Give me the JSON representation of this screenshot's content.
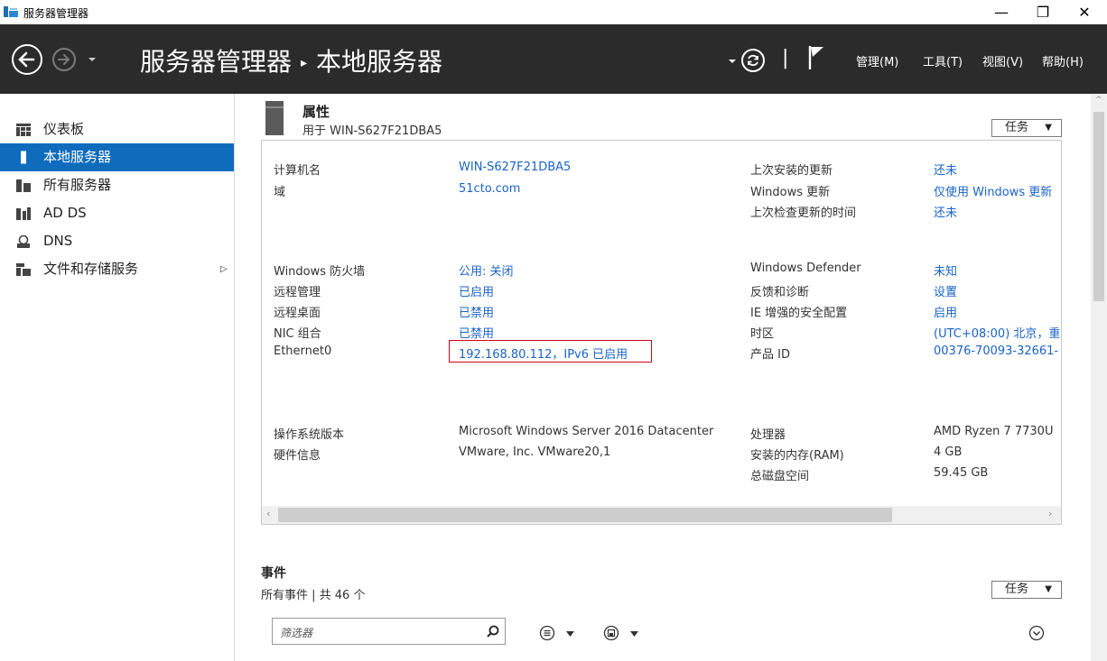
{
  "window": {
    "title": "服务器管理器",
    "minimize": "—",
    "restore": "❐",
    "close": "✕"
  },
  "header": {
    "breadcrumb_root": "服务器管理器",
    "breadcrumb_sep": "▸",
    "breadcrumb_current": "本地服务器",
    "menus": [
      "管理(M)",
      "工具(T)",
      "视图(V)",
      "帮助(H)"
    ],
    "divider": "|"
  },
  "sidebar": {
    "items": [
      {
        "label": "仪表板",
        "icon": "dashboard-icon"
      },
      {
        "label": "本地服务器",
        "icon": "local-server-icon",
        "active": true
      },
      {
        "label": "所有服务器",
        "icon": "all-servers-icon"
      },
      {
        "label": "AD DS",
        "icon": "ad-ds-icon"
      },
      {
        "label": "DNS",
        "icon": "dns-icon"
      },
      {
        "label": "文件和存储服务",
        "icon": "file-storage-icon"
      }
    ],
    "expand_glyph": "▷"
  },
  "properties": {
    "title": "属性",
    "subtitle": "用于 WIN-S627F21DBA5",
    "task_label": "任务",
    "left_col": [
      {
        "label": "计算机名",
        "value": "WIN-S627F21DBA5"
      },
      {
        "label": "域",
        "value": "51cto.com"
      },
      {
        "label": "Windows 防火墙",
        "value": "公用: 关闭"
      },
      {
        "label": "远程管理",
        "value": "已启用"
      },
      {
        "label": "远程桌面",
        "value": "已禁用"
      },
      {
        "label": "NIC 组合",
        "value": "已禁用"
      },
      {
        "label": "Ethernet0",
        "value": "192.168.80.112，IPv6 已启用"
      },
      {
        "label": "操作系统版本",
        "value": "Microsoft Windows Server 2016 Datacenter"
      },
      {
        "label": "硬件信息",
        "value": "VMware, Inc. VMware20,1"
      }
    ],
    "right_col": [
      {
        "label": "上次安装的更新",
        "value": "还未"
      },
      {
        "label": "Windows 更新",
        "value": "仅使用 Windows 更新"
      },
      {
        "label": "上次检查更新的时间",
        "value": "还未"
      },
      {
        "label": "Windows Defender",
        "value": "未知"
      },
      {
        "label": "反馈和诊断",
        "value": "设置"
      },
      {
        "label": "IE 增强的安全配置",
        "value": "启用"
      },
      {
        "label": "时区",
        "value": "(UTC+08:00) 北京，重"
      },
      {
        "label": "产品 ID",
        "value": "00376-70093-32661-"
      },
      {
        "label": "处理器",
        "value": "AMD Ryzen 7 7730U"
      },
      {
        "label": "安装的内存(RAM)",
        "value": "4 GB"
      },
      {
        "label": "总磁盘空间",
        "value": "59.45 GB"
      }
    ]
  },
  "events": {
    "title": "事件",
    "subtitle": "所有事件 | 共 46 个",
    "task_label": "任务",
    "filter_placeholder": "筛选器"
  },
  "colors": {
    "header_bg": "#2b2b2b",
    "accent": "#0f6cbd",
    "link": "#1a63c7",
    "highlight_border": "#d0021b"
  }
}
